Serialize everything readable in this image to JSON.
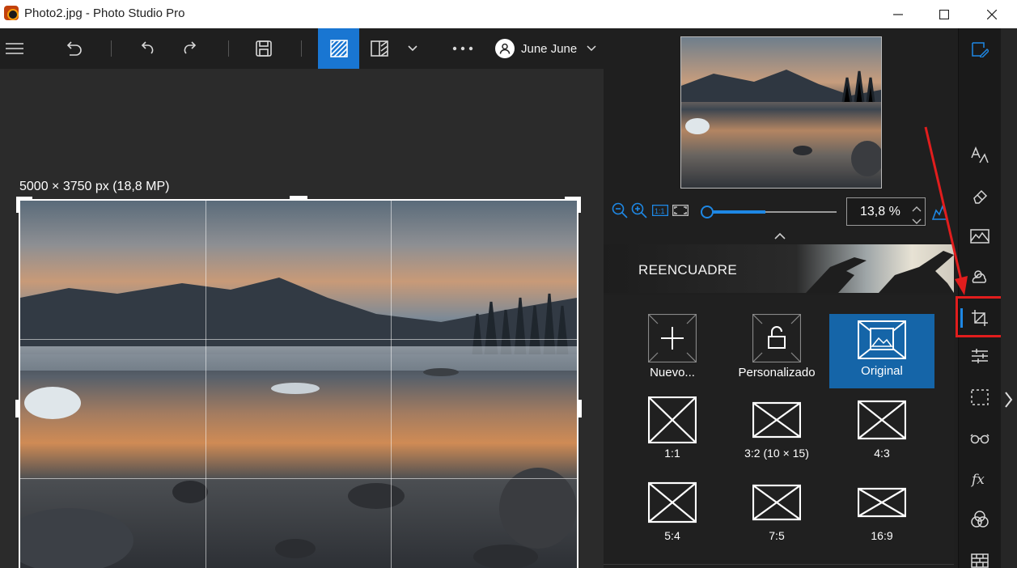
{
  "window": {
    "title": "Photo2.jpg - Photo Studio Pro"
  },
  "toolbar": {
    "menu_icon": "hamburger-menu-icon",
    "user_name": "June June"
  },
  "canvas": {
    "image_dimensions": "5000 × 3750 px (18,8 MP)"
  },
  "zoom": {
    "value": "13,8 %",
    "buttons": [
      "zoom-out-icon",
      "zoom-in-icon",
      "actual-size-icon",
      "fit-to-window-icon"
    ]
  },
  "crop_panel": {
    "title": "REENCUADRE",
    "options": [
      {
        "label": "Nuevo...",
        "icon": "plus-icon",
        "selected": false
      },
      {
        "label": "Personalizado",
        "icon": "lock-icon",
        "selected": false
      },
      {
        "label": "Original",
        "icon": "image-icon",
        "selected": true
      },
      {
        "label": "1:1",
        "icon": "ratio-1-1-icon",
        "selected": false
      },
      {
        "label": "3:2 (10 × 15)",
        "icon": "ratio-3-2-icon",
        "selected": false
      },
      {
        "label": "4:3",
        "icon": "ratio-4-3-icon",
        "selected": false
      },
      {
        "label": "5:4",
        "icon": "ratio-5-4-icon",
        "selected": false
      },
      {
        "label": "7:5",
        "icon": "ratio-7-5-icon",
        "selected": false
      },
      {
        "label": "16:9",
        "icon": "ratio-16-9-icon",
        "selected": false
      }
    ]
  },
  "sidebar": {
    "tools": [
      "edit-icon",
      "text-style-icon",
      "eraser-icon",
      "landscape-icon",
      "weather-icon",
      "crop-icon",
      "adjust-sliders-icon",
      "selection-icon",
      "glasses-icon",
      "fx-icon",
      "color-circles-icon",
      "texture-icon"
    ],
    "active_tool": "crop-icon"
  },
  "colors": {
    "accent": "#1976d2",
    "highlight": "#e11d1d",
    "background": "#2b2b2b"
  }
}
